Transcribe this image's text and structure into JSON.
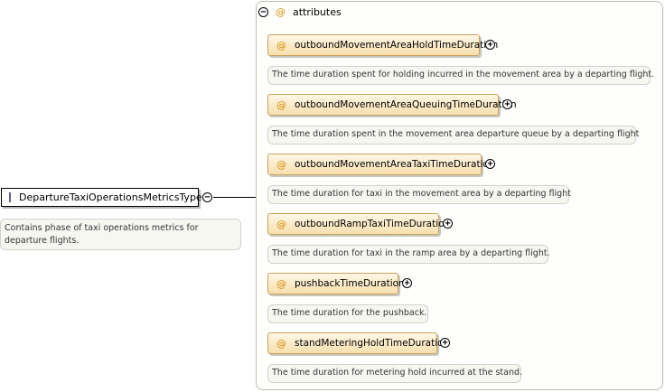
{
  "complex_type": {
    "name": "DepartureTaxiOperationsMetricsType",
    "documentation": "Contains phase of taxi operations metrics for departure flights.",
    "collapse_symbol": "−",
    "icon": "complex-type-icon"
  },
  "attribute_group": {
    "label": "attributes",
    "collapse_symbol": "−",
    "attribute_symbol": "@",
    "attributes": [
      {
        "name": "outboundMovementAreaHoldTimeDuration",
        "documentation": "The time duration spent for holding incurred in the movement area by a departing flight.",
        "expand_symbol": "+"
      },
      {
        "name": "outboundMovementAreaQueuingTimeDuration",
        "documentation": "The time duration spent in the movement area departure queue by a departing flight",
        "expand_symbol": "+"
      },
      {
        "name": "outboundMovementAreaTaxiTimeDuration",
        "documentation": "The time duration for taxi in the movement area by a departing flight",
        "expand_symbol": "+"
      },
      {
        "name": "outboundRampTaxiTimeDuration",
        "documentation": "The time duration for taxi in the ramp area by a departing flight.",
        "expand_symbol": "+"
      },
      {
        "name": "pushbackTimeDuration",
        "documentation": "The time duration for the pushback.",
        "expand_symbol": "+"
      },
      {
        "name": "standMeteringHoldTimeDuration",
        "documentation": "The time duration for metering hold incurred at the stand.",
        "expand_symbol": "+"
      }
    ]
  },
  "colors": {
    "attribute_fill_top": "#fff7e6",
    "attribute_fill_bottom": "#f7dfae",
    "attribute_border": "#c9a25a",
    "attribute_symbol": "#d48a00",
    "type_icon": "#c8b8e6",
    "documentation_fill": "#f7f7f2"
  }
}
